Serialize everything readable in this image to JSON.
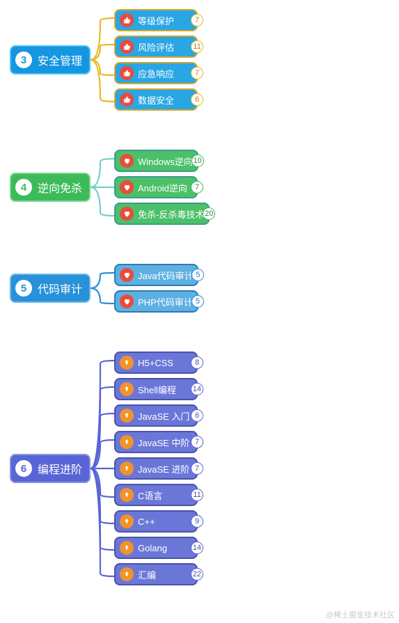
{
  "watermark": "@稀土掘金技术社区",
  "sections": {
    "sec0": {
      "num": "3",
      "label": "安全管理",
      "theme": "blue",
      "conn_color": "#e8b923",
      "children": {
        "c0": {
          "label": "等级保护",
          "count": "7",
          "count_cls": "count-yellow",
          "icon": "thumb"
        },
        "c1": {
          "label": "风险评估",
          "count": "11",
          "count_cls": "count-yellow",
          "icon": "thumb"
        },
        "c2": {
          "label": "应急响应",
          "count": "7",
          "count_cls": "count-yellow",
          "icon": "thumb"
        },
        "c3": {
          "label": "数据安全",
          "count": "6",
          "count_cls": "count-yellow",
          "icon": "thumb"
        }
      }
    },
    "sec1": {
      "num": "4",
      "label": "逆向免杀",
      "theme": "green",
      "conn_color": "#6fd0c7",
      "children": {
        "c0": {
          "label": "Windows逆向",
          "count": "10",
          "count_cls": "count-green",
          "icon": "heart"
        },
        "c1": {
          "label": "Android逆向",
          "count": "7",
          "count_cls": "count-green",
          "icon": "heart"
        },
        "c2": {
          "label": "免杀-反杀毒技术",
          "count": "20",
          "count_cls": "count-green",
          "icon": "heart"
        }
      }
    },
    "sec2": {
      "num": "5",
      "label": "代码审计",
      "theme": "steel",
      "conn_color": "#2891d9",
      "children": {
        "c0": {
          "label": "Java代码审计",
          "count": "5",
          "count_cls": "count-blue",
          "icon": "heart"
        },
        "c1": {
          "label": "PHP代码审计",
          "count": "5",
          "count_cls": "count-blue",
          "icon": "heart"
        }
      }
    },
    "sec3": {
      "num": "6",
      "label": "编程进阶",
      "theme": "purple",
      "conn_color": "#5865d6",
      "children": {
        "c0": {
          "label": "H5+CSS",
          "count": "8",
          "count_cls": "count-purple",
          "icon": "arrow"
        },
        "c1": {
          "label": "Shell编程",
          "count": "14",
          "count_cls": "count-purple",
          "icon": "arrow"
        },
        "c2": {
          "label": "JavaSE 入门",
          "count": "6",
          "count_cls": "count-purple",
          "icon": "arrow"
        },
        "c3": {
          "label": "JavaSE 中阶",
          "count": "7",
          "count_cls": "count-purple",
          "icon": "arrow"
        },
        "c4": {
          "label": "JavaSE 进阶",
          "count": "7",
          "count_cls": "count-purple",
          "icon": "arrow"
        },
        "c5": {
          "label": "C语言",
          "count": "11",
          "count_cls": "count-purple",
          "icon": "arrow"
        },
        "c6": {
          "label": "C++",
          "count": "9",
          "count_cls": "count-purple",
          "icon": "arrow"
        },
        "c7": {
          "label": "Golang",
          "count": "14",
          "count_cls": "count-purple",
          "icon": "arrow"
        },
        "c8": {
          "label": "汇编",
          "count": "22",
          "count_cls": "count-purple",
          "icon": "arrow"
        }
      }
    }
  }
}
